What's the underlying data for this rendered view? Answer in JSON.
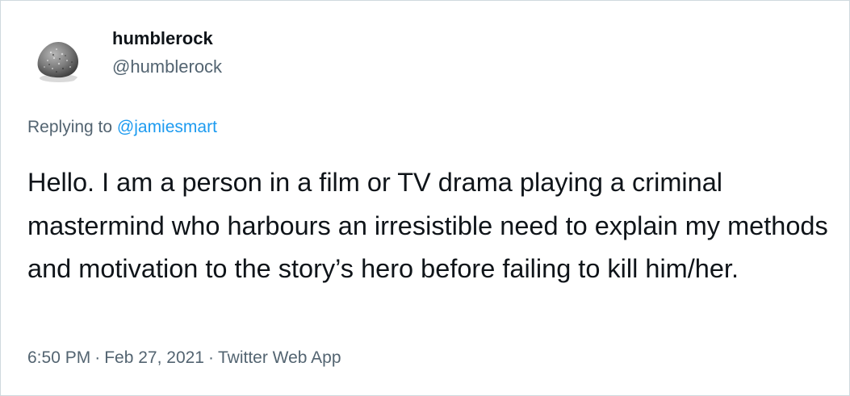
{
  "tweet": {
    "author": {
      "display_name": "humblerock",
      "handle": "@humblerock",
      "avatar_icon": "rock-avatar-icon"
    },
    "reply_prefix": "Replying to",
    "reply_to": "@jamiesmart",
    "text": "Hello. I am a person in a film or TV drama playing a criminal mastermind who harbours an irresistible need to explain my methods and motivation to the story’s hero before failing to kill him/her.",
    "time": "6:50 PM",
    "date": "Feb 27, 2021",
    "separator": "·",
    "source": "Twitter Web App"
  },
  "colors": {
    "text_primary": "#0f1419",
    "text_secondary": "#536471",
    "link": "#1d9bf0",
    "border": "#cfd9de"
  }
}
